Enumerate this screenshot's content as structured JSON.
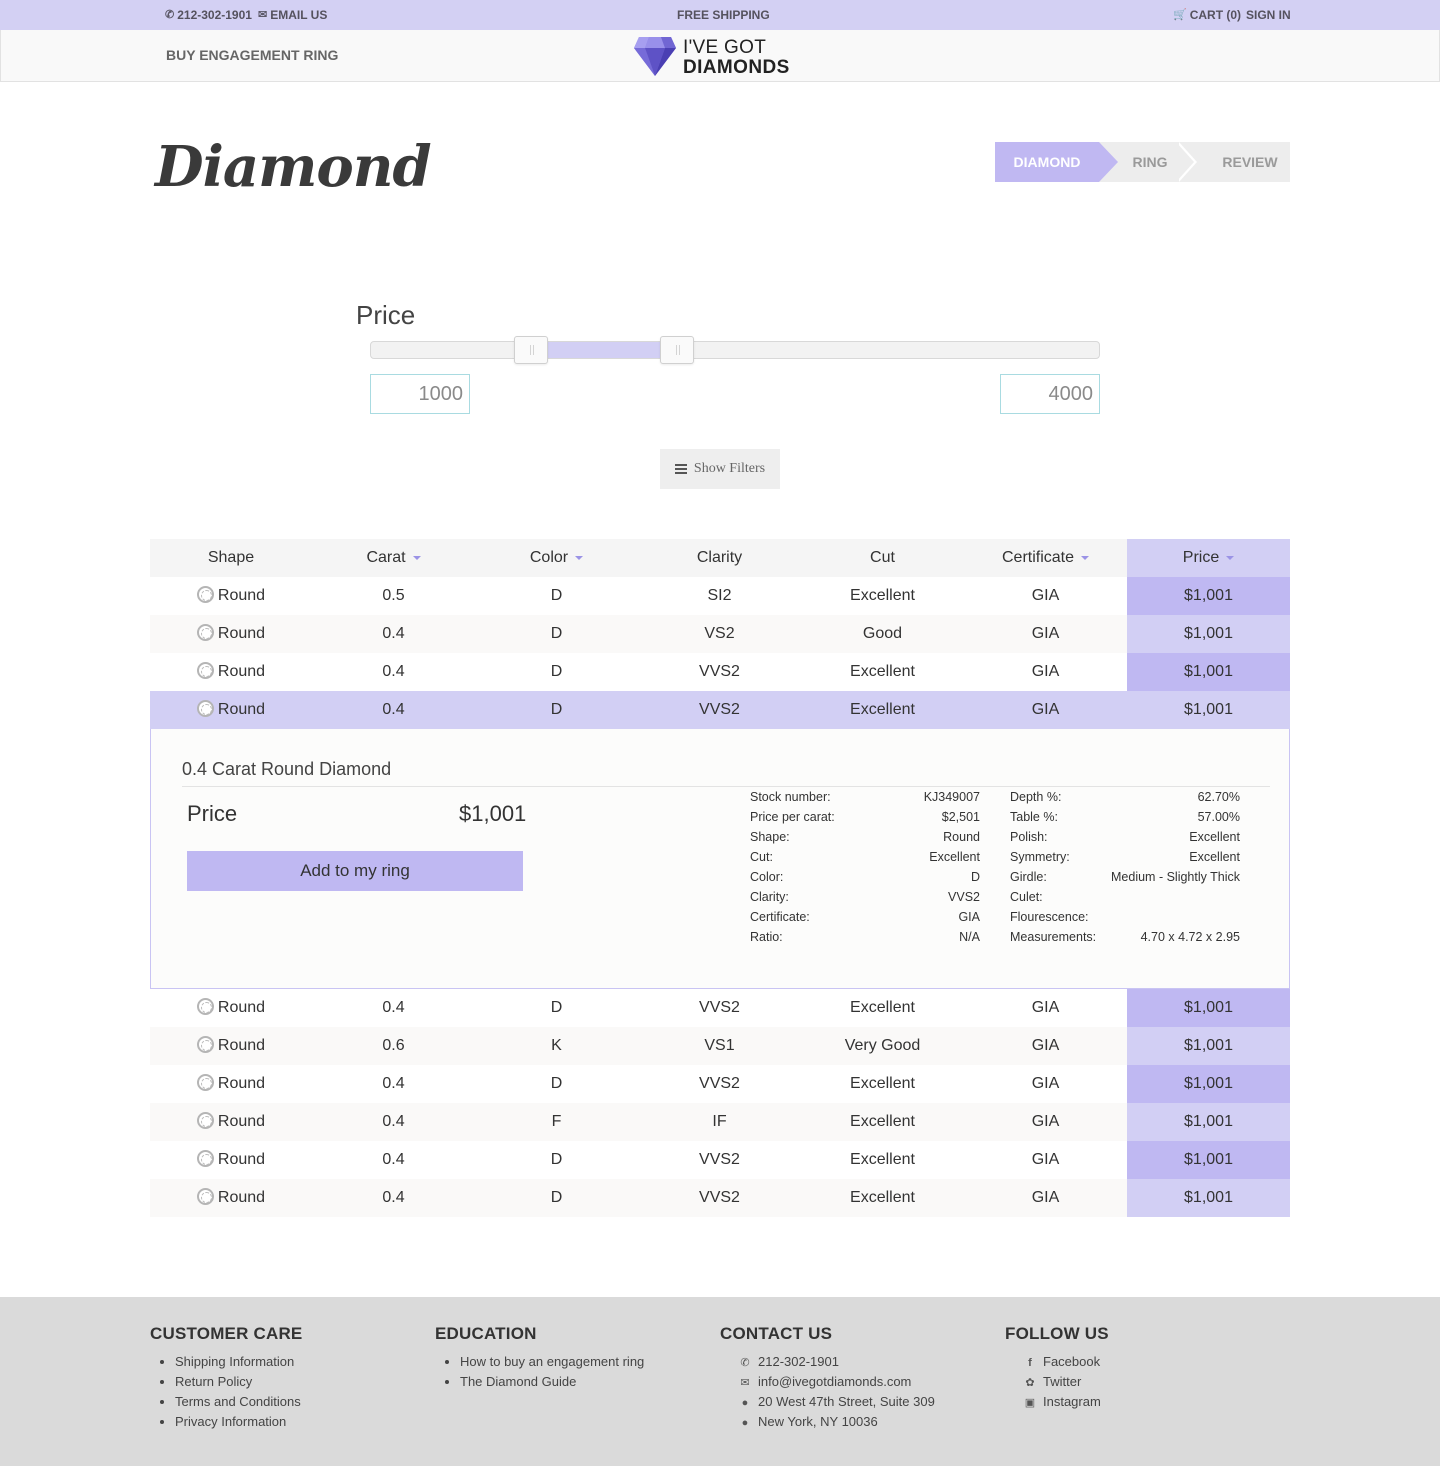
{
  "topbar": {
    "phone": "212-302-1901",
    "email": "EMAIL US",
    "shipping": "FREE SHIPPING",
    "cart": "CART (0)",
    "signin": "SIGN IN"
  },
  "header": {
    "nav_link": "BUY ENGAGEMENT RING",
    "logo_line1": "I'VE GOT",
    "logo_line2": "DIAMONDS"
  },
  "page": {
    "title": "Diamond"
  },
  "steps": [
    "DIAMOND",
    "RING",
    "REVIEW"
  ],
  "price_filter": {
    "label": "Price",
    "min": "1000",
    "max": "4000",
    "lower_fraction": 0.22,
    "upper_fraction": 0.42
  },
  "filters_button": "Show Filters",
  "table": {
    "headers": [
      "Shape",
      "Carat",
      "Color",
      "Clarity",
      "Cut",
      "Certificate",
      "Price"
    ],
    "rows": [
      [
        "Round",
        "0.5",
        "D",
        "SI2",
        "Excellent",
        "GIA",
        "$1,001"
      ],
      [
        "Round",
        "0.4",
        "D",
        "VS2",
        "Good",
        "GIA",
        "$1,001"
      ],
      [
        "Round",
        "0.4",
        "D",
        "VVS2",
        "Excellent",
        "GIA",
        "$1,001"
      ],
      [
        "Round",
        "0.4",
        "D",
        "VVS2",
        "Excellent",
        "GIA",
        "$1,001"
      ],
      [
        "Round",
        "0.4",
        "D",
        "VVS2",
        "Excellent",
        "GIA",
        "$1,001"
      ],
      [
        "Round",
        "0.6",
        "K",
        "VS1",
        "Very Good",
        "GIA",
        "$1,001"
      ],
      [
        "Round",
        "0.4",
        "D",
        "VVS2",
        "Excellent",
        "GIA",
        "$1,001"
      ],
      [
        "Round",
        "0.4",
        "F",
        "IF",
        "Excellent",
        "GIA",
        "$1,001"
      ],
      [
        "Round",
        "0.4",
        "D",
        "VVS2",
        "Excellent",
        "GIA",
        "$1,001"
      ],
      [
        "Round",
        "0.4",
        "D",
        "VVS2",
        "Excellent",
        "GIA",
        "$1,001"
      ]
    ]
  },
  "detail": {
    "title": "0.4 Carat Round Diamond",
    "price_label": "Price",
    "price_value": "$1,001",
    "add_button": "Add to my ring",
    "specs_left": [
      {
        "k": "Stock number:",
        "v": "KJ349007"
      },
      {
        "k": "Price per carat:",
        "v": "$2,501"
      },
      {
        "k": "Shape:",
        "v": "Round"
      },
      {
        "k": "Cut:",
        "v": "Excellent"
      },
      {
        "k": "Color:",
        "v": "D"
      },
      {
        "k": "Clarity:",
        "v": "VVS2"
      },
      {
        "k": "Certificate:",
        "v": "GIA"
      },
      {
        "k": "Ratio:",
        "v": "N/A"
      }
    ],
    "specs_right": [
      {
        "k": "Depth %:",
        "v": "62.70%"
      },
      {
        "k": "Table %:",
        "v": "57.00%"
      },
      {
        "k": "Polish:",
        "v": "Excellent"
      },
      {
        "k": "Symmetry:",
        "v": "Excellent"
      },
      {
        "k": "Girdle:",
        "v": "Medium - Slightly Thick"
      },
      {
        "k": "Culet:",
        "v": ""
      },
      {
        "k": "Flourescence:",
        "v": ""
      },
      {
        "k": "Measurements:",
        "v": "4.70 x 4.72 x 2.95"
      }
    ]
  },
  "footer": {
    "customer_care": {
      "title": "CUSTOMER CARE",
      "links": [
        "Shipping Information",
        "Return Policy",
        "Terms and Conditions",
        "Privacy Information"
      ]
    },
    "education": {
      "title": "EDUCATION",
      "links": [
        "How to buy an engagement ring",
        "The Diamond Guide"
      ]
    },
    "contact": {
      "title": "CONTACT US",
      "phone": "212-302-1901",
      "email": "info@ivegotdiamonds.com",
      "address1": "20 West 47th Street, Suite 309",
      "address2": "New York, NY 10036"
    },
    "follow": {
      "title": "FOLLOW US",
      "links": [
        "Facebook",
        "Twitter",
        "Instagram"
      ]
    }
  },
  "colors": {
    "accent": "#bfb8f2",
    "accent_light": "#d2cff4",
    "topbar": "#d3d0f3",
    "footer": "#dadada"
  }
}
